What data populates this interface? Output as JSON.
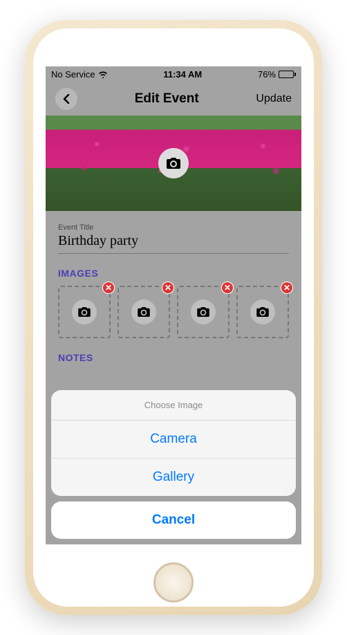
{
  "statusBar": {
    "carrier": "No Service",
    "time": "11:34 AM",
    "batteryPercent": "76%"
  },
  "nav": {
    "title": "Edit Event",
    "action": "Update"
  },
  "form": {
    "titleLabel": "Event Title",
    "titleValue": "Birthday party",
    "imagesLabel": "IMAGES",
    "notesLabel": "NOTES"
  },
  "actionSheet": {
    "header": "Choose Image",
    "option1": "Camera",
    "option2": "Gallery",
    "cancel": "Cancel"
  }
}
